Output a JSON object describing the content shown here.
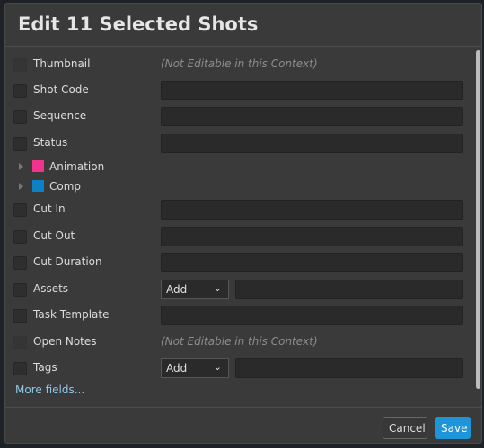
{
  "dialog": {
    "title": "Edit 11 Selected Shots",
    "not_editable": "(Not Editable in this Context)",
    "fields": {
      "thumbnail": "Thumbnail",
      "shot_code": "Shot Code",
      "sequence": "Sequence",
      "status": "Status",
      "cut_in": "Cut In",
      "cut_out": "Cut Out",
      "cut_duration": "Cut Duration",
      "assets": "Assets",
      "task_template": "Task Template",
      "open_notes": "Open Notes",
      "tags": "Tags"
    },
    "tasks": [
      {
        "label": "Animation",
        "color": "#f0348c"
      },
      {
        "label": "Comp",
        "color": "#0c82c4"
      }
    ],
    "assets_mode": "Add",
    "tags_mode": "Add",
    "more_fields": "More fields...",
    "cancel": "Cancel",
    "save": "Save",
    "accent": "#1e95d9"
  }
}
